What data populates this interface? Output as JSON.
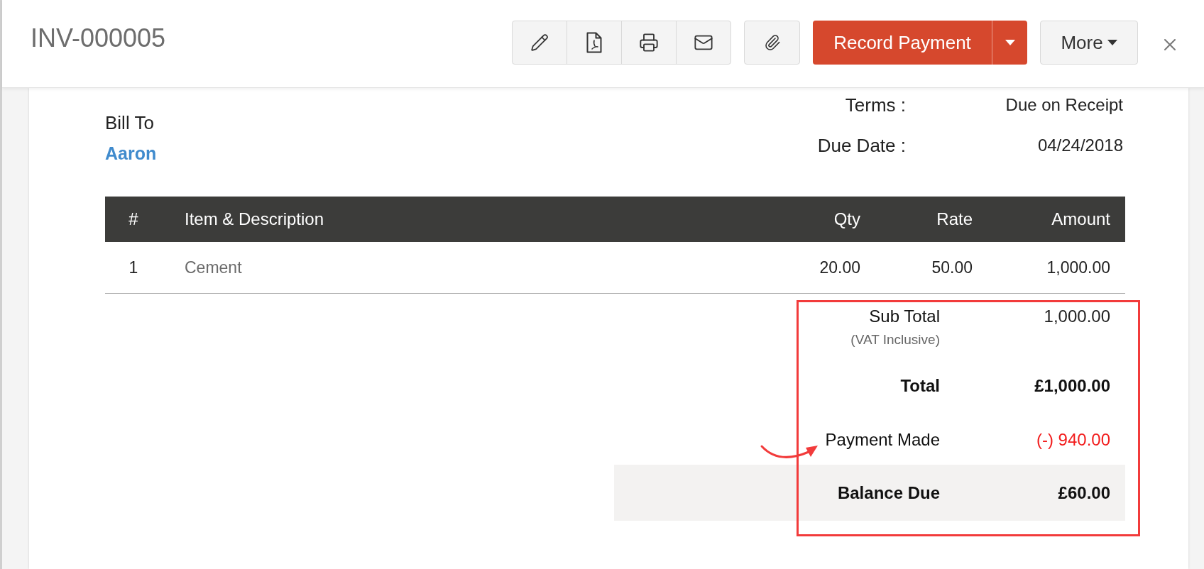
{
  "header": {
    "title": "INV-000005",
    "primary_action": "Record Payment",
    "more_menu": "More"
  },
  "bill_to": {
    "label": "Bill To",
    "customer": "Aaron"
  },
  "terms": [
    {
      "label": "Terms :",
      "value": "Due on Receipt"
    },
    {
      "label": "Due Date :",
      "value": "04/24/2018"
    }
  ],
  "table": {
    "columns": [
      "#",
      "Item & Description",
      "Qty",
      "Rate",
      "Amount"
    ],
    "rows": [
      [
        "1",
        "Cement",
        "20.00",
        "50.00",
        "1,000.00"
      ]
    ]
  },
  "totals": [
    {
      "kind": "subtotal",
      "label": "Sub Total",
      "note": "(VAT Inclusive)",
      "value": "1,000.00"
    },
    {
      "kind": "total",
      "label": "Total",
      "value": "£1,000.00"
    },
    {
      "kind": "payment",
      "label": "Payment Made",
      "value": "(-) 940.00"
    },
    {
      "kind": "balance",
      "label": "Balance Due",
      "value": "£60.00"
    }
  ]
}
